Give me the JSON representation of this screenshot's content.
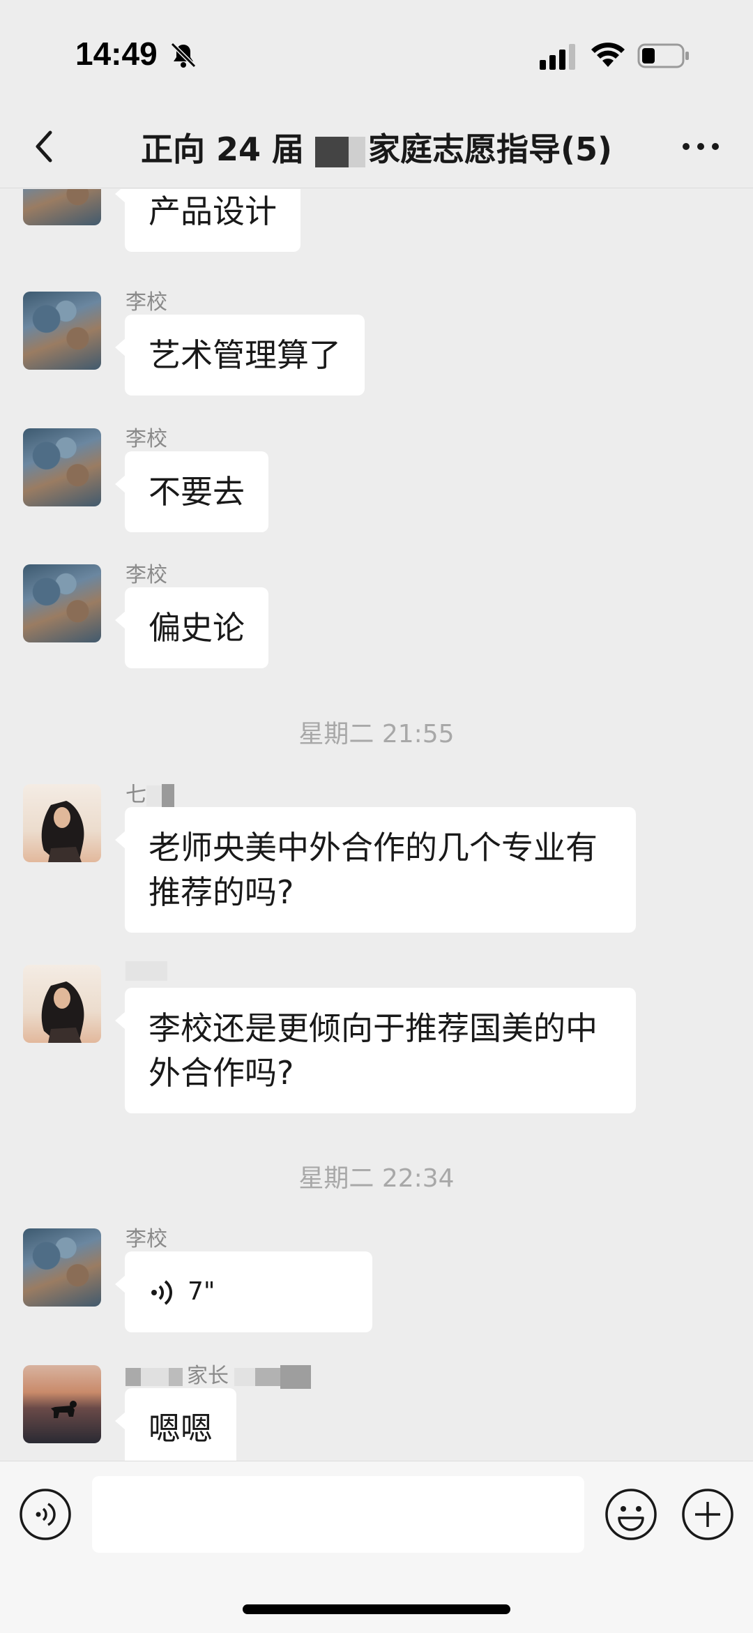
{
  "status": {
    "time": "14:49"
  },
  "nav": {
    "title_prefix": "正向 24 届",
    "title_suffix": "家庭志愿指导(5)"
  },
  "messages": {
    "m0": {
      "text": "产品设计"
    },
    "m1": {
      "sender": "李校",
      "text": "艺术管理算了"
    },
    "m2": {
      "sender": "李校",
      "text": "不要去"
    },
    "m3": {
      "sender": "李校",
      "text": "偏史论"
    },
    "sep1": "星期二 21:55",
    "m4": {
      "sender_visible": "七",
      "text": "老师央美中外合作的几个专业有推荐的吗?"
    },
    "m5": {
      "text": "李校还是更倾向于推荐国美的中外合作吗?"
    },
    "sep2": "星期二 22:34",
    "m6": {
      "sender": "李校",
      "voice_duration": "7\""
    },
    "m7": {
      "sender_visible": "家长",
      "text": "嗯嗯"
    }
  },
  "colors": {
    "background": "#ededed",
    "bubble": "#ffffff",
    "sender": "#8a8a8a",
    "timestamp": "#a8a8a8"
  },
  "icons": {
    "status": [
      "bell-off-icon",
      "signal-icon",
      "wifi-icon",
      "battery-icon"
    ],
    "nav": [
      "back-chevron-icon",
      "more-icon"
    ],
    "input": [
      "voice-icon",
      "emoji-icon",
      "plus-icon"
    ]
  }
}
